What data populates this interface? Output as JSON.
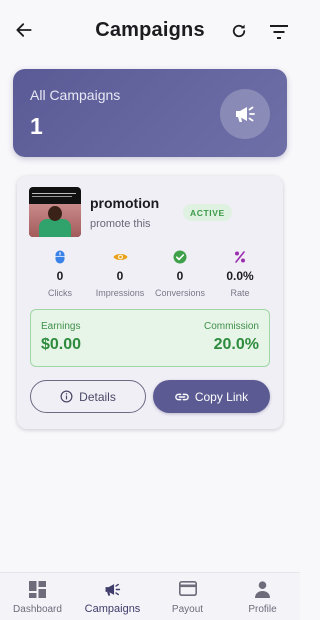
{
  "header": {
    "title": "Campaigns",
    "back_icon": "arrow-left-icon",
    "refresh_icon": "refresh-icon",
    "filter_icon": "filter-icon"
  },
  "summary": {
    "label": "All Campaigns",
    "count": "1",
    "icon": "megaphone-icon"
  },
  "campaign": {
    "name": "promotion",
    "description": "promote this",
    "status": "ACTIVE",
    "stats": [
      {
        "icon": "mouse-icon",
        "value": "0",
        "label": "Clicks",
        "color": "#3b82e8"
      },
      {
        "icon": "eye-icon",
        "value": "0",
        "label": "Impressions",
        "color": "#e8a21b"
      },
      {
        "icon": "check-circle-icon",
        "value": "0",
        "label": "Conversions",
        "color": "#3fa04a"
      },
      {
        "icon": "percent-icon",
        "value": "0.0%",
        "label": "Rate",
        "color": "#9b2fb0"
      }
    ],
    "earnings_label": "Earnings",
    "earnings_value": "$0.00",
    "commission_label": "Commission",
    "commission_value": "20.0%",
    "details_label": "Details",
    "copy_label": "Copy Link"
  },
  "nav": {
    "items": [
      {
        "label": "Dashboard",
        "icon": "dashboard-icon"
      },
      {
        "label": "Campaigns",
        "icon": "megaphone-icon"
      },
      {
        "label": "Payout",
        "icon": "card-icon"
      },
      {
        "label": "Profile",
        "icon": "person-icon"
      }
    ],
    "active": "Campaigns"
  },
  "colors": {
    "accent": "#5b5a92",
    "success": "#2e8b3e"
  }
}
